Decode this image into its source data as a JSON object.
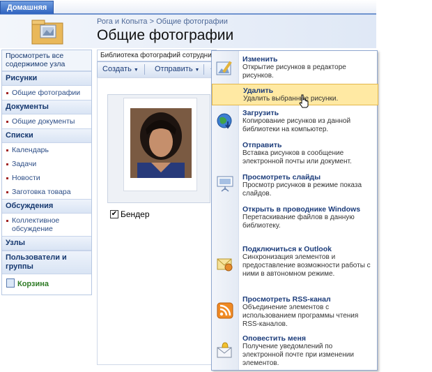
{
  "top_tab": "Домашняя",
  "breadcrumb": {
    "site": "Рога и Копыта",
    "sep": ">",
    "current": "Общие фотографии"
  },
  "page_title": "Общие фотографии",
  "left_nav": {
    "view_all": "Просмотреть все содержимое узла",
    "sections": [
      {
        "title": "Рисунки",
        "items": [
          "Общие фотографии"
        ]
      },
      {
        "title": "Документы",
        "items": [
          "Общие документы"
        ]
      },
      {
        "title": "Списки",
        "items": [
          "Календарь",
          "Задачи",
          "Новости",
          "Заготовка товара"
        ]
      },
      {
        "title": "Обсуждения",
        "items": [
          "Коллективное обсуждение"
        ]
      }
    ],
    "sites": "Узлы",
    "people": "Пользователи и группы",
    "recycle": "Корзина"
  },
  "library_bar": "Библиотека фотографий сотруднико",
  "toolbar": {
    "create": "Создать",
    "send": "Отправить"
  },
  "photo": {
    "label": "Бендер",
    "checked": "✔"
  },
  "menu": [
    {
      "title": "Изменить",
      "desc": "Открытие рисунков в редакторе рисунков.",
      "icon": "edit-picture-icon"
    },
    {
      "title": "Удалить",
      "desc": "Удалить выбранные рисунки.",
      "icon": "delete-icon"
    },
    {
      "title": "Загрузить",
      "desc": "Копирование рисунков из данной библиотеки на компьютер.",
      "icon": "download-globe-icon"
    },
    {
      "title": "Отправить",
      "desc": "Вставка рисунков в сообщение электронной почты или документ.",
      "icon": "send-icon"
    },
    {
      "title": "Просмотреть слайды",
      "desc": "Просмотр рисунков в режиме показа слайдов.",
      "icon": "slideshow-icon"
    },
    {
      "title": "Открыть в проводнике Windows",
      "desc": "Перетаскивание файлов в данную библиотеку.",
      "icon": "explorer-icon"
    },
    {
      "title": "Подключиться к Outlook",
      "desc": "Синхронизация элементов и предоставление возможности работы с ними в автономном режиме.",
      "icon": "outlook-icon"
    },
    {
      "title": "Просмотреть RSS-канал",
      "desc": "Объединение элементов с использованием программы чтения RSS-каналов.",
      "icon": "rss-icon"
    },
    {
      "title": "Оповестить меня",
      "desc": "Получение уведомлений по электронной почте при изменении элементов.",
      "icon": "alert-me-icon"
    }
  ]
}
